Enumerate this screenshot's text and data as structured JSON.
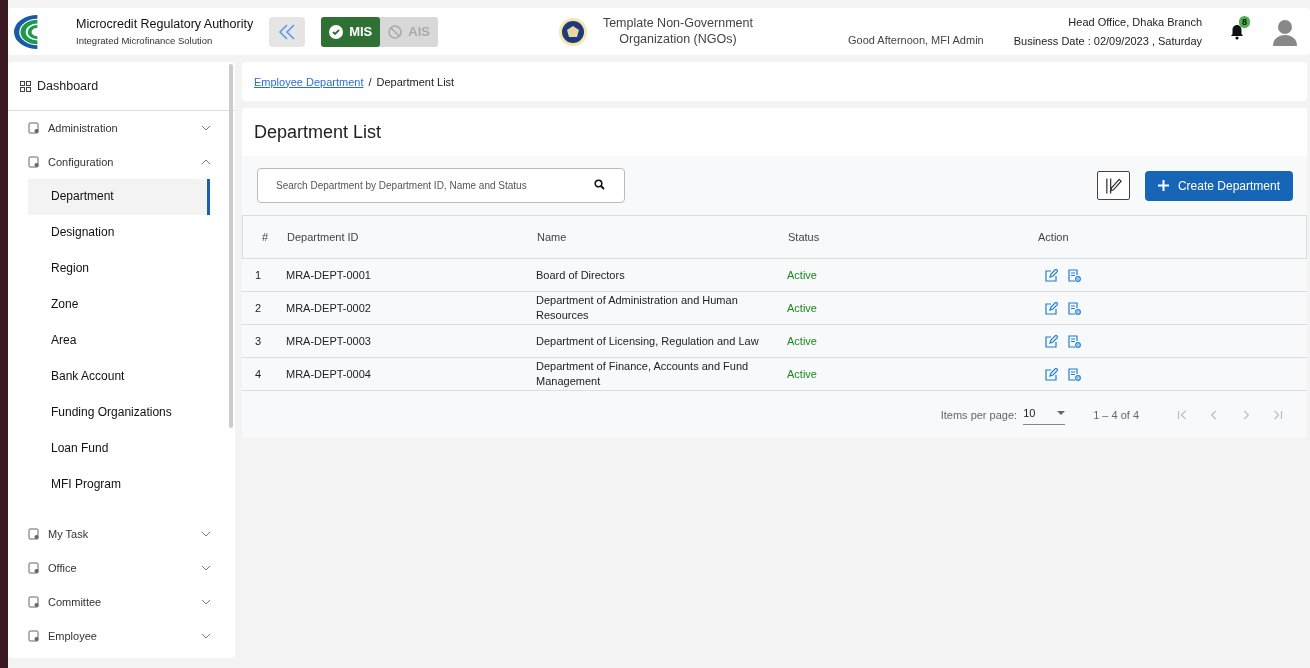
{
  "header": {
    "org_title": "Microcredit Regulatory Authority",
    "org_subtitle": "Integrated Microfinance Solution",
    "modes": [
      {
        "label": "MIS",
        "selected": true
      },
      {
        "label": "AIS",
        "selected": false
      }
    ],
    "ngo_name": "Template Non-Government Organization (NGOs)",
    "greeting": "Good Afternoon, MFI Admin",
    "branch": "Head Office, Dhaka Branch",
    "business_date": "Business Date : 02/09/2023 , Saturday",
    "notification_count": "8"
  },
  "sidebar": {
    "items": [
      {
        "label": "Dashboard",
        "kind": "link"
      },
      {
        "label": "Administration",
        "kind": "group",
        "expanded": false
      },
      {
        "label": "Configuration",
        "kind": "group",
        "expanded": true,
        "children": [
          {
            "label": "Department",
            "selected": true
          },
          {
            "label": "Designation",
            "selected": false
          },
          {
            "label": "Region",
            "selected": false
          },
          {
            "label": "Zone",
            "selected": false
          },
          {
            "label": "Area",
            "selected": false
          },
          {
            "label": "Bank Account",
            "selected": false
          },
          {
            "label": "Funding Organizations",
            "selected": false
          },
          {
            "label": "Loan Fund",
            "selected": false
          },
          {
            "label": "MFI Program",
            "selected": false
          }
        ]
      },
      {
        "label": "My Task",
        "kind": "group",
        "expanded": false
      },
      {
        "label": "Office",
        "kind": "group",
        "expanded": false
      },
      {
        "label": "Committee",
        "kind": "group",
        "expanded": false
      },
      {
        "label": "Employee",
        "kind": "group",
        "expanded": false
      }
    ]
  },
  "breadcrumb": [
    {
      "label": "Employee Department",
      "kind": "link"
    },
    {
      "label": "/",
      "kind": "separator"
    },
    {
      "label": "Department List",
      "kind": "current"
    }
  ],
  "page_title": "Department List",
  "search": {
    "placeholder": "Search Department by Department ID, Name and Status"
  },
  "create_button": "Create Department",
  "table": {
    "columns": [
      "#",
      "Department ID",
      "Name",
      "Status",
      "Action"
    ],
    "rows": [
      {
        "index": "1",
        "id": "MRA-DEPT-0001",
        "name": "Board of Directors",
        "status": "Active"
      },
      {
        "index": "2",
        "id": "MRA-DEPT-0002",
        "name": "Department of Administration and Human Resources",
        "status": "Active"
      },
      {
        "index": "3",
        "id": "MRA-DEPT-0003",
        "name": "Department of Licensing, Regulation and Law",
        "status": "Active"
      },
      {
        "index": "4",
        "id": "MRA-DEPT-0004",
        "name": "Department of Finance, Accounts and Fund Management",
        "status": "Active"
      }
    ]
  },
  "pagination": {
    "items_per_page_label": "Items per page:",
    "page_size": "10",
    "range": "1 – 4 of 4",
    "first_disabled": true,
    "previous_disabled": true,
    "next_disabled": true,
    "last_disabled": true
  }
}
